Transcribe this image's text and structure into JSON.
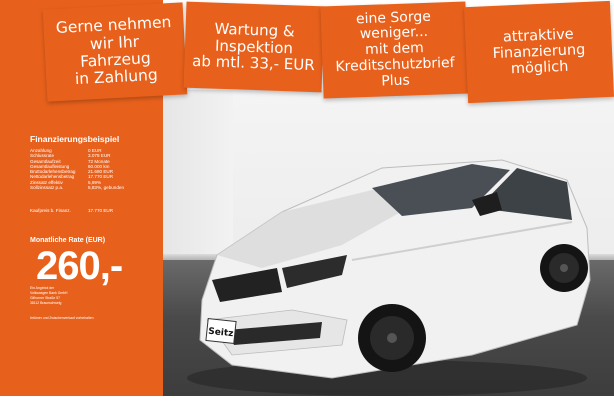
{
  "banners": [
    {
      "lines": [
        "Gerne nehmen",
        "wir Ihr",
        "Fahrzeug",
        "in Zahlung"
      ]
    },
    {
      "lines": [
        "Wartung &",
        "Inspektion",
        "ab mtl. 33,- EUR"
      ]
    },
    {
      "lines": [
        "eine Sorge weniger...",
        "mit dem",
        "Kreditschutzbrief",
        "Plus"
      ]
    },
    {
      "lines": [
        "attraktive",
        "Finanzierung",
        "möglich"
      ]
    }
  ],
  "finance": {
    "title": "Finanzierungsbeispiel",
    "rows": [
      {
        "label": "Anzahlung",
        "value": "0 EUR"
      },
      {
        "label": "Schlussrate",
        "value": "3.078 EUR"
      },
      {
        "label": "Gesamtlaufzeit",
        "value": "72 Monate"
      },
      {
        "label": "Gesamtlaufleistung",
        "value": "60.000 km"
      },
      {
        "label": "Bruttodarlehensbetrag",
        "value": "21.680 EUR"
      },
      {
        "label": "Nettodarlehensbetrag",
        "value": "17.770 EUR"
      },
      {
        "label": "Zinssatz effektiv",
        "value": "5,99%"
      },
      {
        "label": "Sollzinssatz p.a.",
        "value": "5,83%, gebunden"
      }
    ],
    "kaufpreis_label": "Kaufpreis b. Finanz.",
    "kaufpreis_value": "17.770 EUR",
    "rate_label": "Monatliche Rate (EUR)",
    "rate_value": "260,-",
    "lender_lines": [
      "Ein Angebot der",
      "Volkswagen Bank GmbH",
      "Gifhorner Straße 57",
      "38112 Braunschweig"
    ],
    "footnote": "Irrtümer und Zwischenverkauf vorbehalten"
  },
  "car": {
    "plate_text": "Seitz",
    "colors": {
      "body": "#f2f2f2",
      "wheels": "#1b1b1b",
      "accent": "#e8611c"
    }
  }
}
